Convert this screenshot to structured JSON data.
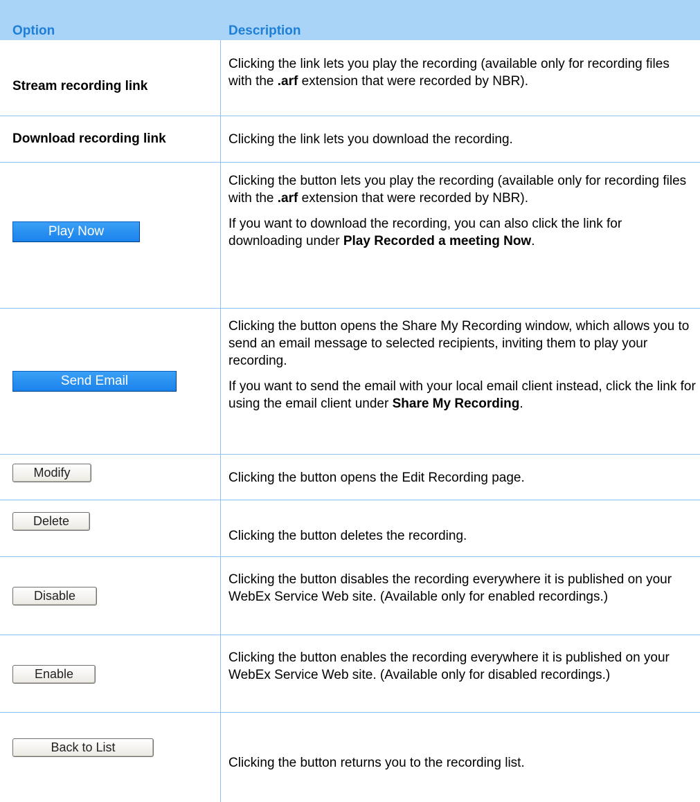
{
  "header": {
    "option": "Option",
    "description": "Description"
  },
  "rows": [
    {
      "option": "Stream recording link",
      "desc": [
        [
          {
            "t": "Clicking the link lets you play the recording (available only for recording files with the ",
            "b": false
          },
          {
            "t": ".arf",
            "b": true
          },
          {
            "t": " extension that were recorded by NBR).",
            "b": false
          }
        ]
      ]
    },
    {
      "option": "Download recording link",
      "desc": [
        [
          {
            "t": "Clicking the link lets you download the recording.",
            "b": false
          }
        ]
      ]
    },
    {
      "option": "Play Now",
      "desc": [
        [
          {
            "t": "Clicking the button lets you play the recording (available only for recording files with the ",
            "b": false
          },
          {
            "t": ".arf",
            "b": true
          },
          {
            "t": " extension that were recorded by NBR).",
            "b": false
          }
        ],
        [
          {
            "t": "If you want to download the recording, you can also click the link for downloading under ",
            "b": false
          },
          {
            "t": "Play Recorded a meeting Now",
            "b": true
          },
          {
            "t": ".",
            "b": false
          }
        ]
      ]
    },
    {
      "option": "Send Email",
      "desc": [
        [
          {
            "t": "Clicking the button opens the Share My Recording window, which allows you to send an email message to selected recipients, inviting them to play your recording.",
            "b": false
          }
        ],
        [
          {
            "t": "If you want to send the email with your local email client instead, click the link for using the email client under ",
            "b": false
          },
          {
            "t": "Share My Recording",
            "b": true
          },
          {
            "t": ".",
            "b": false
          }
        ]
      ]
    },
    {
      "option": "Modify",
      "desc": [
        [
          {
            "t": "Clicking the button opens the Edit Recording page.",
            "b": false
          }
        ]
      ]
    },
    {
      "option": "Delete",
      "desc": [
        [
          {
            "t": "Clicking the button deletes the recording.",
            "b": false
          }
        ]
      ]
    },
    {
      "option": "Disable",
      "desc": [
        [
          {
            "t": "Clicking the button disables the recording everywhere it is published on your WebEx Service Web site. (Available only for enabled recordings.)",
            "b": false
          }
        ]
      ]
    },
    {
      "option": "Enable",
      "desc": [
        [
          {
            "t": "Clicking the button enables the recording everywhere it is published on your WebEx Service Web site. (Available only for disabled recordings.)",
            "b": false
          }
        ]
      ]
    },
    {
      "option": "Back to List",
      "desc": [
        [
          {
            "t": "Clicking the button returns you to the recording list.",
            "b": false
          }
        ]
      ]
    }
  ]
}
